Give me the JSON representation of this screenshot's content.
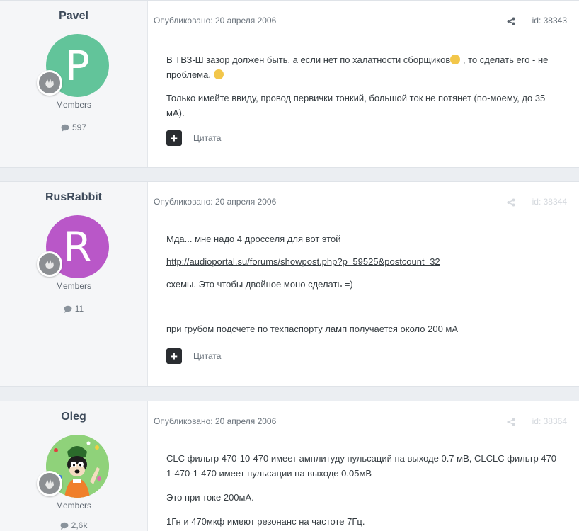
{
  "posts": [
    {
      "author": "Pavel",
      "avatar_letter": "P",
      "avatar_color": "#62c49a",
      "group": "Members",
      "post_count": "597",
      "published": "Опубликовано: 20 апреля 2006",
      "id": "id: 38343",
      "paragraphs": [
        [
          "В ТВЗ-Ш зазор должен быть, а если нет по халатности сборщиков",
          " , то сделать его - не проблема. "
        ],
        [
          "Только имейте ввиду, провод первички тонкий, большой ток не потянет (по-моему, до 35 мА)."
        ]
      ],
      "quote_label": "Цитата"
    },
    {
      "author": "RusRabbit",
      "avatar_letter": "R",
      "avatar_color": "#b957c8",
      "group": "Members",
      "post_count": "11",
      "published": "Опубликовано: 20 апреля 2006",
      "id": "id: 38344",
      "lines": {
        "l1": "Мда... мне надо 4 дросселя для вот этой",
        "link": "http://audioportal.su/forums/showpost.php?p=59525&postcount=32",
        "l2": "схемы. Это чтобы двойное моно сделать =)",
        "l3": "при грубом подсчете по техпаспорту ламп получается около 200 мА"
      },
      "quote_label": "Цитата"
    },
    {
      "author": "Oleg",
      "avatar_color": "#7bc86a",
      "group": "Members",
      "post_count": "2,6k",
      "published": "Опубликовано: 20 апреля 2006",
      "id": "id: 38364",
      "lines": {
        "l1": "CLC фильтр 470-10-470 имеет амплитуду пульсаций на выходе 0.7 мВ, CLCLC фильтр 470-1-470-1-470 имеет пульсации на выходе 0.05мВ",
        "l2": "Это при токе 200мА.",
        "l3": "1Гн и 470мкф имеют резонанс на частоте 7Гц."
      }
    }
  ]
}
